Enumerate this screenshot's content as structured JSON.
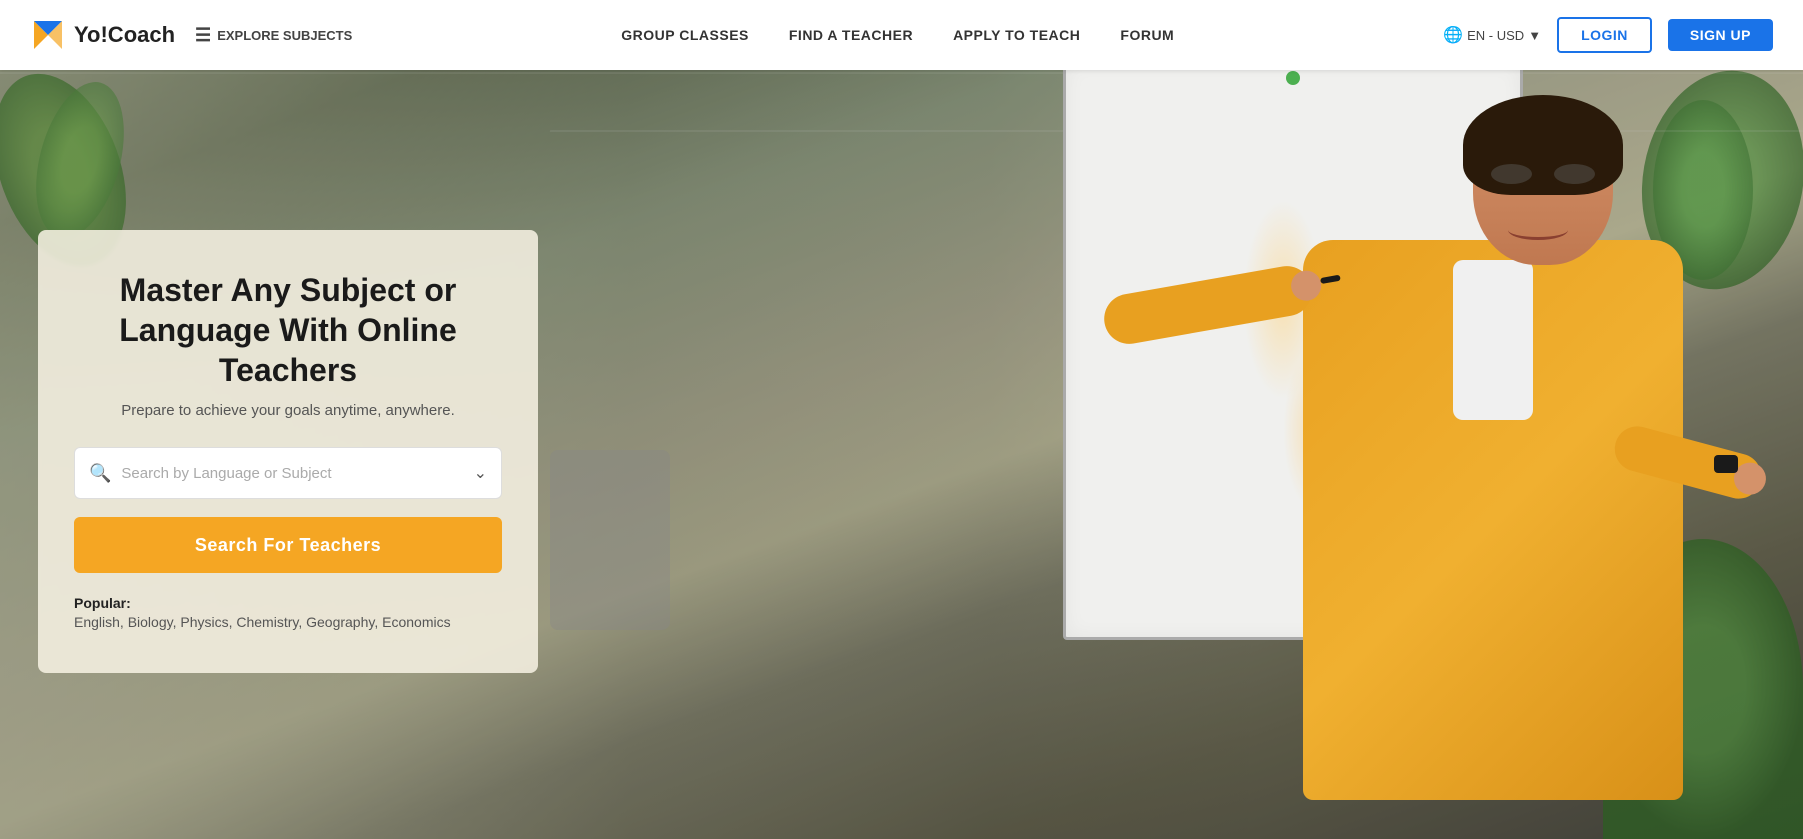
{
  "nav": {
    "logo_text": "Yo!Coach",
    "explore_label": "EXPLORE SUBJECTS",
    "links": [
      {
        "id": "group-classes",
        "label": "GROUP CLASSES"
      },
      {
        "id": "find-teacher",
        "label": "FIND A TEACHER"
      },
      {
        "id": "apply-teach",
        "label": "APPLY TO TEACH"
      },
      {
        "id": "forum",
        "label": "FORUM"
      }
    ],
    "lang": "EN - USD",
    "login_label": "LOGIN",
    "signup_label": "SIGN UP"
  },
  "hero": {
    "title": "Master Any Subject or Language With Online Teachers",
    "subtitle": "Prepare to achieve your goals anytime, anywhere.",
    "search_placeholder": "Search by Language or Subject",
    "search_button": "Search For Teachers",
    "popular_label": "Popular:",
    "popular_tags": "English, Biology, Physics, Chemistry, Geography, Economics"
  }
}
